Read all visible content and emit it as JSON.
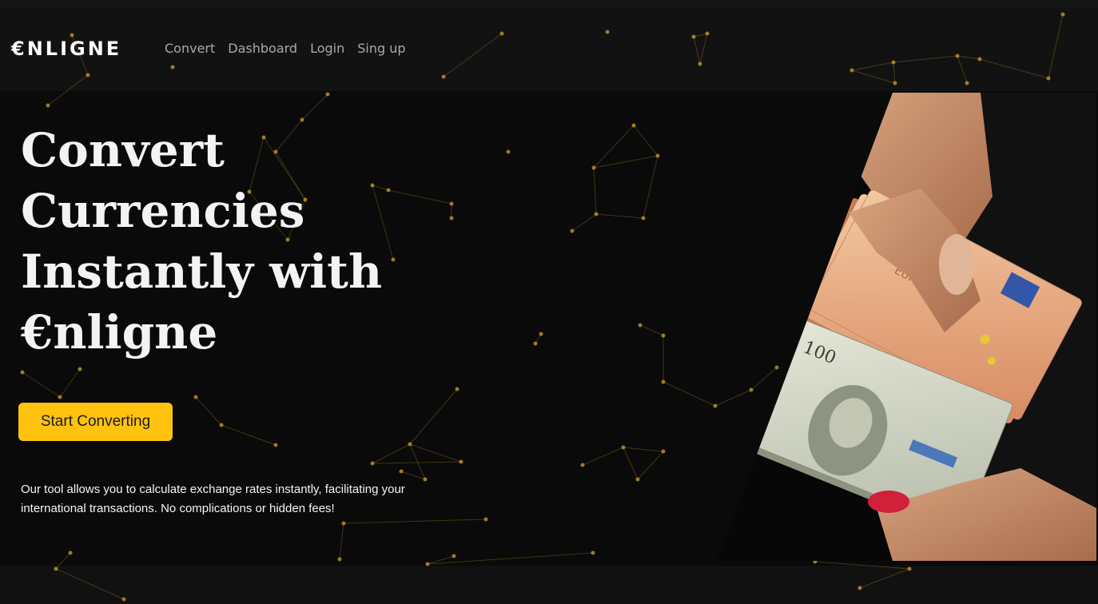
{
  "brand": {
    "logo": "€NLIGNE",
    "accent_color": "#ffc20e"
  },
  "nav": {
    "items": [
      {
        "label": "Convert"
      },
      {
        "label": "Dashboard"
      },
      {
        "label": "Login"
      },
      {
        "label": "Sing up"
      }
    ]
  },
  "hero": {
    "title_lines": [
      "Convert",
      "Currencies",
      "Instantly with",
      "€nligne"
    ],
    "cta_label": "Start Converting",
    "description": "Our tool allows you to calculate exchange rates instantly, facilitating your international transactions. No complications or hidden fees!",
    "image": {
      "alt": "hands exchanging euro and dollar banknotes",
      "icon": "money-exchange-photo"
    }
  },
  "colors": {
    "background": "#0a0a0a",
    "header": "#121212",
    "node": "#caa22c"
  }
}
